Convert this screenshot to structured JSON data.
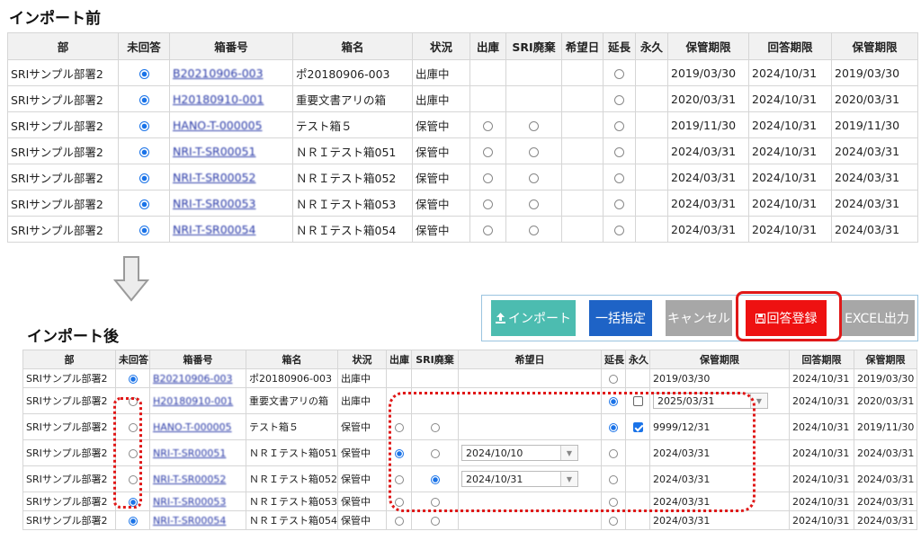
{
  "before": {
    "title": "インポート前",
    "headers": [
      "部",
      "未回答",
      "箱番号",
      "箱名",
      "状況",
      "出庫",
      "SRI廃棄",
      "希望日",
      "延長",
      "永久",
      "保管期限",
      "回答期限",
      "保管期限"
    ],
    "rows": [
      {
        "dept": "SRIサンプル部署2",
        "unanswered": true,
        "box_no": "B20210906-003",
        "box_name": "ポ20180906-003",
        "status": "出庫中",
        "out": null,
        "sri": null,
        "ext": false,
        "period": "2019/03/30",
        "answer": "2024/10/31",
        "period2": "2019/03/30"
      },
      {
        "dept": "SRIサンプル部署2",
        "unanswered": true,
        "box_no": "H20180910-001",
        "box_name": "重要文書アリの箱",
        "status": "出庫中",
        "out": null,
        "sri": null,
        "ext": false,
        "period": "2020/03/31",
        "answer": "2024/10/31",
        "period2": "2020/03/31"
      },
      {
        "dept": "SRIサンプル部署2",
        "unanswered": true,
        "box_no": "HANO-T-000005",
        "box_name": "テスト箱５",
        "status": "保管中",
        "out": false,
        "sri": false,
        "ext": false,
        "period": "2019/11/30",
        "answer": "2024/10/31",
        "period2": "2019/11/30"
      },
      {
        "dept": "SRIサンプル部署2",
        "unanswered": true,
        "box_no": "NRI-T-SR00051",
        "box_name": "ＮＲＩテスト箱051",
        "status": "保管中",
        "out": false,
        "sri": false,
        "ext": false,
        "period": "2024/03/31",
        "answer": "2024/10/31",
        "period2": "2024/03/31"
      },
      {
        "dept": "SRIサンプル部署2",
        "unanswered": true,
        "box_no": "NRI-T-SR00052",
        "box_name": "ＮＲＩテスト箱052",
        "status": "保管中",
        "out": false,
        "sri": false,
        "ext": false,
        "period": "2024/03/31",
        "answer": "2024/10/31",
        "period2": "2024/03/31"
      },
      {
        "dept": "SRIサンプル部署2",
        "unanswered": true,
        "box_no": "NRI-T-SR00053",
        "box_name": "ＮＲＩテスト箱053",
        "status": "保管中",
        "out": false,
        "sri": false,
        "ext": false,
        "period": "2024/03/31",
        "answer": "2024/10/31",
        "period2": "2024/03/31"
      },
      {
        "dept": "SRIサンプル部署2",
        "unanswered": true,
        "box_no": "NRI-T-SR00054",
        "box_name": "ＮＲＩテスト箱054",
        "status": "保管中",
        "out": false,
        "sri": false,
        "ext": false,
        "period": "2024/03/31",
        "answer": "2024/10/31",
        "period2": "2024/03/31"
      }
    ]
  },
  "after": {
    "title": "インポート後",
    "headers": [
      "部",
      "未回答",
      "箱番号",
      "箱名",
      "状況",
      "出庫",
      "SRI廃棄",
      "希望日",
      "延長",
      "永久",
      "保管期限",
      "回答期限",
      "保管期限"
    ],
    "rows": [
      {
        "dept": "SRIサンプル部署2",
        "unanswered": true,
        "box_no": "B20210906-003",
        "box_name": "ポ20180906-003",
        "status": "出庫中",
        "out": null,
        "sri": null,
        "wish": null,
        "ext": false,
        "perm": null,
        "period": "2019/03/30",
        "period_dd": false,
        "answer": "2024/10/31",
        "period2": "2019/03/30"
      },
      {
        "dept": "SRIサンプル部署2",
        "unanswered": false,
        "box_no": "H20180910-001",
        "box_name": "重要文書アリの箱",
        "status": "出庫中",
        "out": null,
        "sri": null,
        "wish": null,
        "ext": true,
        "perm": false,
        "period": "2025/03/31",
        "period_dd": true,
        "answer": "2024/10/31",
        "period2": "2020/03/31"
      },
      {
        "dept": "SRIサンプル部署2",
        "unanswered": false,
        "box_no": "HANO-T-000005",
        "box_name": "テスト箱５",
        "status": "保管中",
        "out": false,
        "sri": false,
        "wish": null,
        "ext": true,
        "perm": true,
        "period": "9999/12/31",
        "period_dd": false,
        "answer": "2024/10/31",
        "period2": "2019/11/30"
      },
      {
        "dept": "SRIサンプル部署2",
        "unanswered": false,
        "box_no": "NRI-T-SR00051",
        "box_name": "ＮＲＩテスト箱051",
        "status": "保管中",
        "out": true,
        "sri": false,
        "wish": "2024/10/10",
        "ext": false,
        "perm": null,
        "period": "2024/03/31",
        "period_dd": false,
        "answer": "2024/10/31",
        "period2": "2024/03/31"
      },
      {
        "dept": "SRIサンプル部署2",
        "unanswered": false,
        "box_no": "NRI-T-SR00052",
        "box_name": "ＮＲＩテスト箱052",
        "status": "保管中",
        "out": false,
        "sri": true,
        "wish": "2024/10/31",
        "ext": false,
        "perm": null,
        "period": "2024/03/31",
        "period_dd": false,
        "answer": "2024/10/31",
        "period2": "2024/03/31"
      },
      {
        "dept": "SRIサンプル部署2",
        "unanswered": true,
        "box_no": "NRI-T-SR00053",
        "box_name": "ＮＲＩテスト箱053",
        "status": "保管中",
        "out": false,
        "sri": false,
        "wish": null,
        "ext": false,
        "perm": null,
        "period": "2024/03/31",
        "period_dd": false,
        "answer": "2024/10/31",
        "period2": "2024/03/31"
      },
      {
        "dept": "SRIサンプル部署2",
        "unanswered": true,
        "box_no": "NRI-T-SR00054",
        "box_name": "ＮＲＩテスト箱054",
        "status": "保管中",
        "out": false,
        "sri": false,
        "wish": null,
        "ext": false,
        "perm": null,
        "period": "2024/03/31",
        "period_dd": false,
        "answer": "2024/10/31",
        "period2": "2024/03/31"
      }
    ]
  },
  "toolbar": {
    "import_label": "インポート",
    "import_icon": "upload-icon",
    "bulk_label": "一括指定",
    "cancel_label": "キャンセル",
    "register_label": "回答登録",
    "register_icon": "save-icon",
    "excel_label": "EXCEL出力"
  },
  "colors": {
    "accent": "#1a73e8",
    "import_button": "#4cbcb0",
    "bulk_button": "#1e63c6",
    "gray_button": "#a7a7a7",
    "register_button": "#ee1111",
    "highlight": "#e01818"
  }
}
